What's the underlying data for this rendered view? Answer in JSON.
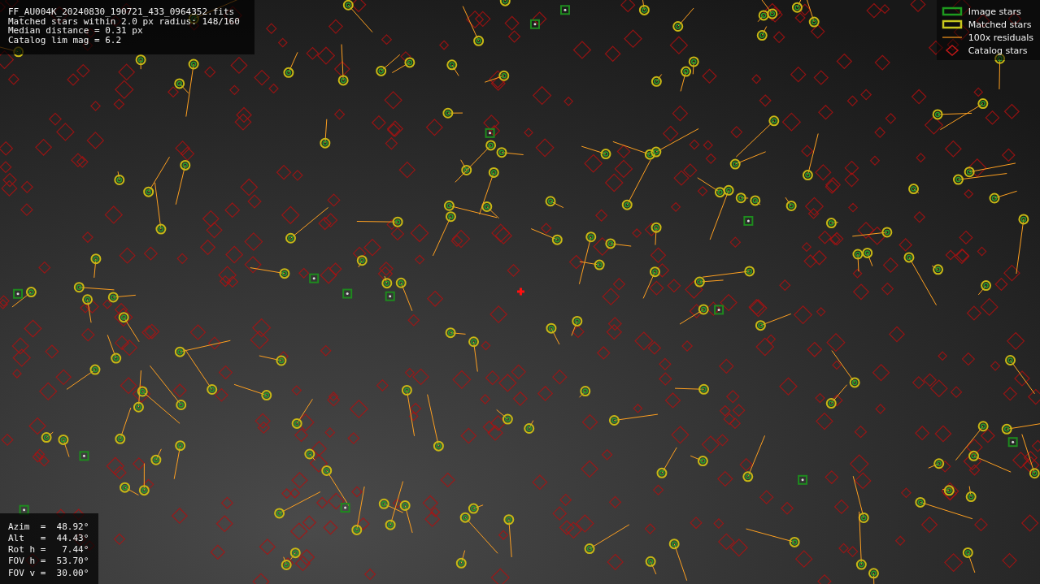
{
  "file_info": {
    "lines": [
      "FF_AU004K_20240830_190721_433_0964352.fits",
      "Matched stars within 2.0 px radius: 148/160",
      "Median distance = 0.31 px",
      "Catalog lim mag = 6.2"
    ]
  },
  "legend": {
    "items": [
      {
        "kind": "image",
        "label": "Image stars"
      },
      {
        "kind": "matched",
        "label": "Matched stars"
      },
      {
        "kind": "residual",
        "label": "100x residuals"
      },
      {
        "kind": "catalog",
        "label": "Catalog stars"
      }
    ]
  },
  "pointing": {
    "lines": [
      "Azim  =  48.92°",
      "Alt   =  44.43°",
      "Rot h =   7.44°",
      "FOV h =  53.70°",
      "FOV v =  30.00°"
    ]
  }
}
